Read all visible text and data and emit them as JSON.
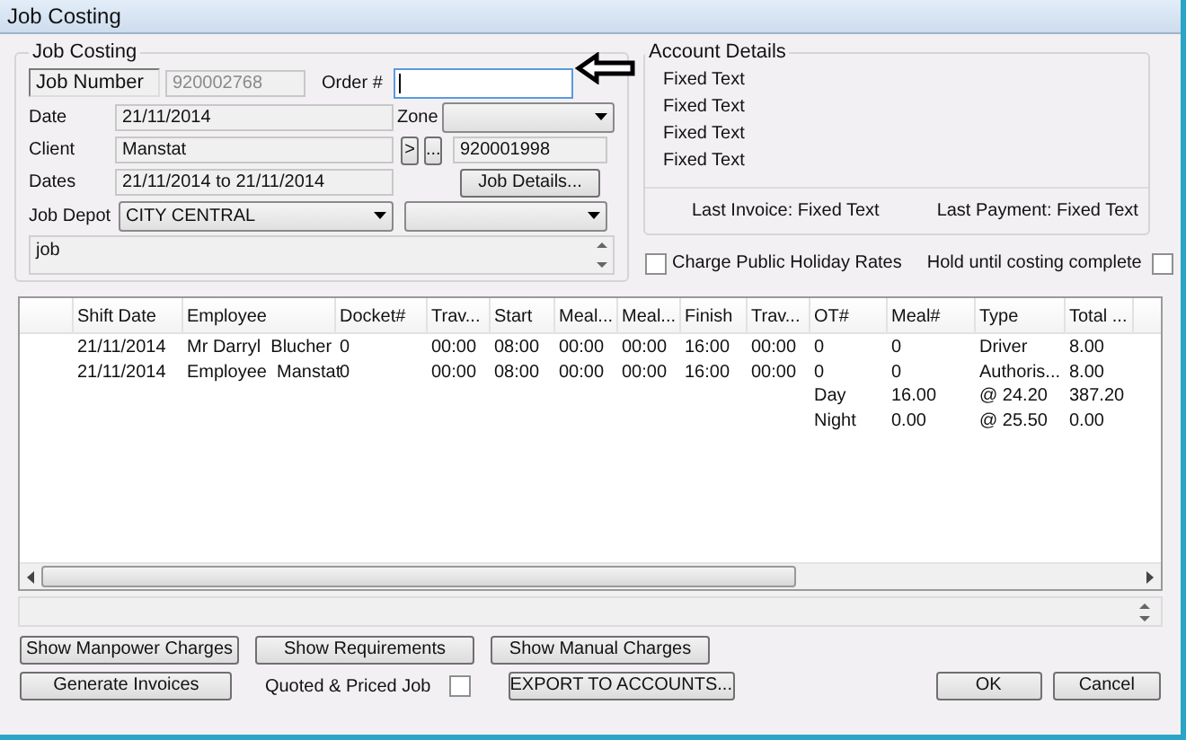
{
  "window": {
    "title": "Job Costing"
  },
  "job_costing": {
    "title": "Job Costing",
    "job_number_label": "Job Number",
    "job_number": "920002768",
    "order_label": "Order #",
    "date_label": "Date",
    "date": "21/11/2014",
    "zone_label": "Zone",
    "client_label": "Client",
    "client": "Manstat",
    "client_buttons": [
      ">",
      "..."
    ],
    "client_code": "920001998",
    "dates_label": "Dates",
    "dates": "21/11/2014 to 21/11/2014",
    "job_details_button": "Job Details...",
    "job_depot_label": "Job Depot",
    "job_depot": "CITY CENTRAL",
    "notes": "job"
  },
  "account_details": {
    "title": "Account Details",
    "lines": [
      "Fixed Text",
      "Fixed Text",
      "Fixed Text",
      "Fixed Text"
    ],
    "last_invoice": "Last Invoice: Fixed Text",
    "last_payment": "Last Payment: Fixed Text"
  },
  "charge_public_holiday": {
    "label": "Charge Public Holiday Rates",
    "checked": false
  },
  "hold_until_costing": {
    "label": "Hold until costing complete",
    "checked": false
  },
  "table": {
    "columns": [
      "Shift Date",
      "Employee",
      "Docket#",
      "Trav...",
      "Start",
      "Meal...",
      "Meal...",
      "Finish",
      "Trav...",
      "OT#",
      "Meal#",
      "Type",
      "Total ..."
    ],
    "rows": [
      {
        "kind": "entry",
        "cells": [
          "21/11/2014",
          "Mr Darryl  Blucher",
          "0",
          "00:00",
          "08:00",
          "00:00",
          "00:00",
          "16:00",
          "00:00",
          "0",
          "0",
          "Driver",
          "8.00"
        ]
      },
      {
        "kind": "entry",
        "cells": [
          "21/11/2014",
          "Employee  Manstat",
          "0",
          "00:00",
          "08:00",
          "00:00",
          "00:00",
          "16:00",
          "00:00",
          "0",
          "0",
          "Authoris...",
          "8.00"
        ]
      },
      {
        "kind": "summary",
        "cells": [
          "Day",
          "16.00",
          "@ 24.20",
          "387.20"
        ]
      },
      {
        "kind": "summary",
        "cells": [
          "Night",
          "0.00",
          "@ 25.50",
          "0.00"
        ]
      }
    ]
  },
  "buttons_row_1": [
    "Show Manpower Charges",
    "Show Requirements",
    "Show Manual Charges"
  ],
  "generate_invoices_button": "Generate Invoices",
  "quoted_priced_job": {
    "label": "Quoted & Priced Job",
    "checked": false
  },
  "export_button": "EXPORT TO ACCOUNTS...",
  "ok_button": "OK",
  "cancel_button": "Cancel"
}
